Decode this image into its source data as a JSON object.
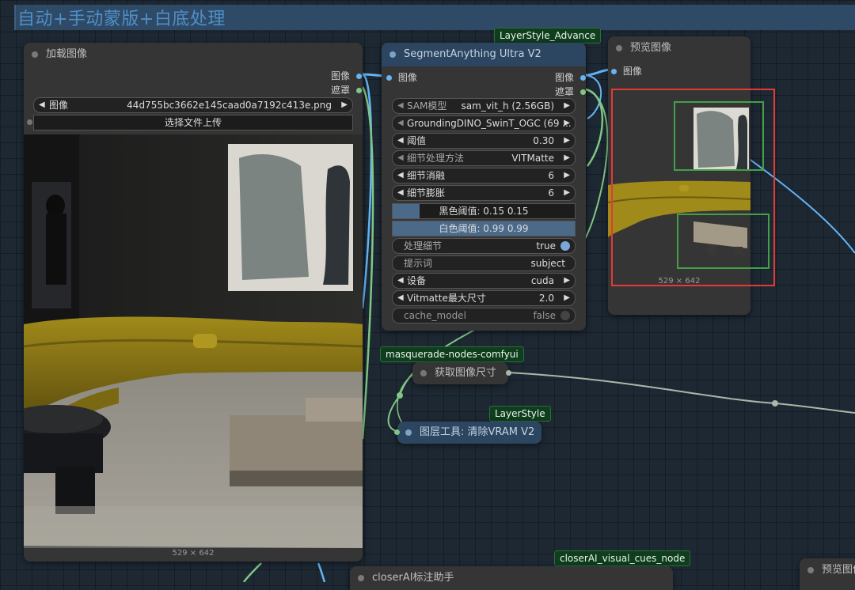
{
  "group": {
    "title": "自动+手动蒙版+白底处理"
  },
  "load_node": {
    "title": "加载图像",
    "outputs": {
      "image": "图像",
      "mask": "遮罩"
    },
    "image_label": "图像",
    "filename": "44d755bc3662e145caad0a7192c413e.png",
    "upload_label": "选择文件上传",
    "dimensions": "529 × 642"
  },
  "seg_node": {
    "tag": "LayerStyle_Advance",
    "title": "SegmentAnything Ultra V2",
    "input_image": "图像",
    "outputs": {
      "image": "图像",
      "mask": "遮罩"
    },
    "widgets": [
      {
        "label": "SAM模型",
        "value": "sam_vit_h (2.56GB)"
      },
      {
        "label": "GroundingDINO_SwinT_OGC (69 ...",
        "value": ""
      },
      {
        "label": "阈值",
        "value": "0.30"
      },
      {
        "label": "细节处理方法",
        "value": "VITMatte"
      },
      {
        "label": "细节消融",
        "value": "6"
      },
      {
        "label": "细节膨胀",
        "value": "6"
      }
    ],
    "black_threshold": "黑色阈值: 0.15  0.15",
    "white_threshold": "白色阈值: 0.99  0.99",
    "process_detail": {
      "label": "处理细节",
      "value": "true"
    },
    "prompt": {
      "label": "提示词",
      "value": "subject"
    },
    "device": {
      "label": "设备",
      "value": "cuda"
    },
    "vitmatte_max": {
      "label": "Vitmatte最大尺寸",
      "value": "2.0"
    },
    "cache_model": {
      "label": "cache_model",
      "value": "false"
    }
  },
  "preview_node": {
    "title": "预览图像",
    "input_image": "图像",
    "dimensions": "529 × 642"
  },
  "size_node": {
    "tag": "masquerade-nodes-comfyui",
    "title": "获取图像尺寸"
  },
  "vram_node": {
    "tag": "LayerStyle",
    "title": "图层工具: 清除VRAM V2"
  },
  "closer_node": {
    "tag": "closerAI_visual_cues_node",
    "title": "closerAI标注助手"
  },
  "preview_node_2": {
    "title": "预览图像"
  },
  "colors": {
    "link_blue": "#64b5f6",
    "link_green": "#81c784",
    "highlight_red": "#e53935",
    "highlight_green": "#43a047"
  }
}
